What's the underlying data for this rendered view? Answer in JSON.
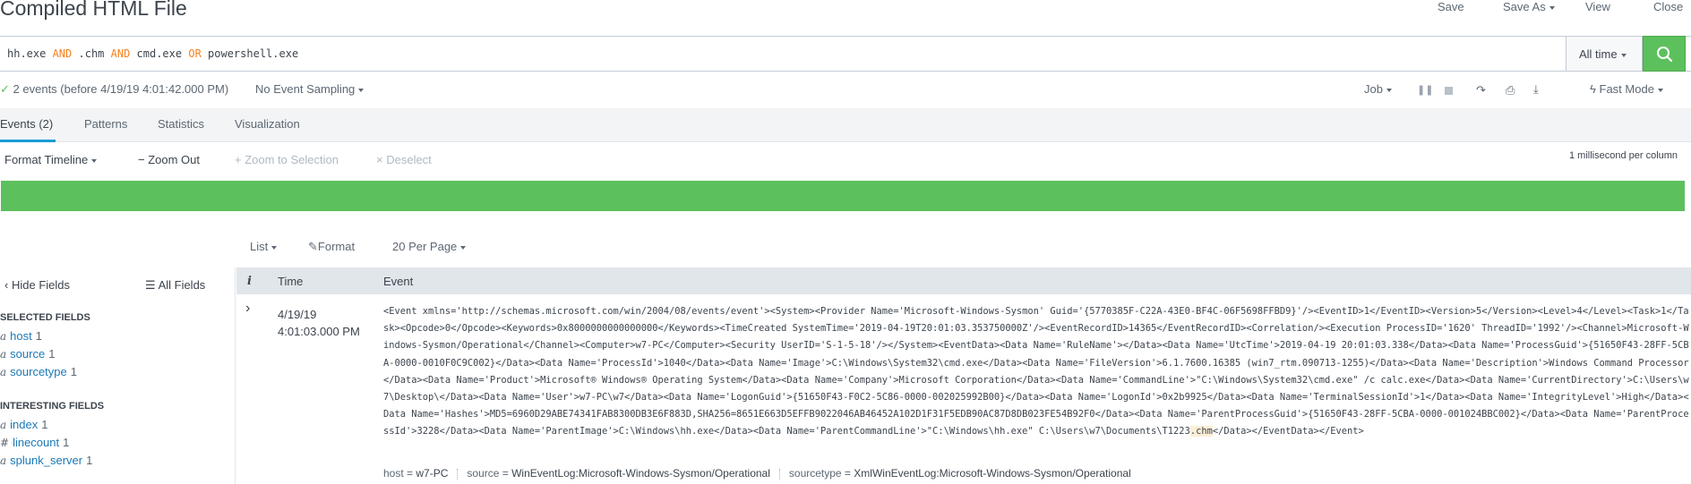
{
  "header": {
    "title": "Compiled HTML File",
    "save": "Save",
    "save_as": "Save As",
    "view": "View",
    "close": "Close"
  },
  "search": {
    "q1": "hh.exe ",
    "op1": "AND",
    "q2": " .chm ",
    "op2": "AND",
    "q3": " cmd.exe ",
    "op3": "OR",
    "q4": " powershell.exe",
    "time_range": "All time",
    "search_icon": "search-icon"
  },
  "status": {
    "summary": "2 events (before 4/19/19 4:01:42.000 PM)",
    "sampling": "No Event Sampling",
    "job": "Job",
    "mode": "Fast Mode"
  },
  "tabs": [
    {
      "label": "Events (2)"
    },
    {
      "label": "Patterns"
    },
    {
      "label": "Statistics"
    },
    {
      "label": "Visualization"
    }
  ],
  "timeline": {
    "format": "Format Timeline",
    "zoom_out": "Zoom Out",
    "zoom_selection": "Zoom to Selection",
    "deselect": "Deselect",
    "scale": "1 millisecond per column",
    "bar_color": "#5cc05c"
  },
  "results": {
    "list": "List",
    "format": "Format",
    "per_page": "20 Per Page",
    "col_info": "i",
    "col_time": "Time",
    "col_event": "Event"
  },
  "sidebar": {
    "hide_fields": "Hide Fields",
    "all_fields": "All Fields",
    "selected_header": "SELECTED FIELDS",
    "selected": [
      {
        "type": "a",
        "name": "host",
        "count": "1"
      },
      {
        "type": "a",
        "name": "source",
        "count": "1"
      },
      {
        "type": "a",
        "name": "sourcetype",
        "count": "1"
      }
    ],
    "interesting_header": "INTERESTING FIELDS",
    "interesting": [
      {
        "type": "a",
        "name": "index",
        "count": "1"
      },
      {
        "type": "#",
        "name": "linecount",
        "count": "1"
      },
      {
        "type": "a",
        "name": "splunk_server",
        "count": "1"
      }
    ]
  },
  "event": {
    "date": "4/19/19",
    "time": "4:01:03.000 PM",
    "raw_a": "<Event xmlns='http://schemas.microsoft.com/win/2004/08/events/event'><System><Provider Name='Microsoft-Windows-Sysmon' Guid='{5770385F-C22A-43E0-BF4C-06F5698FFBD9}'/><EventID>1</EventID><Version>5</Version><Level>4</Level><Task>1</Task><Opcode>0</Opcode><Keywords>0x8000000000000000</Keywords><TimeCreated SystemTime='2019-04-19T20:01:03.353750000Z'/><EventRecordID>14365</EventRecordID><Correlation/><Execution ProcessID='1620' ThreadID='1992'/><Channel>Microsoft-Windows-Sysmon/Operational</Channel><Computer>w7-PC</Computer><Security UserID='S-1-5-18'/></System><EventData><Data Name='RuleName'></Data><Data Name='UtcTime'>2019-04-19 20:01:03.338</Data><Data Name='ProcessGuid'>{51650F43-28FF-5CBA-0000-0010F0C9C002}</Data><Data Name='ProcessId'>1040</Data><Data Name='Image'>C:\\Windows\\System32\\cmd.exe</Data><Data Name='FileVersion'>6.1.7600.16385 (win7_rtm.090713-1255)</Data><Data Name='Description'>Windows Command Processor</Data><Data Name='Product'>Microsoft® Windows® Operating System</Data><Data Name='Company'>Microsoft Corporation</Data><Data Name='CommandLine'>\"C:\\Windows\\System32\\cmd.exe\" /c calc.exe</Data><Data Name='CurrentDirectory'>C:\\Users\\w7\\Desktop\\</Data><Data Name='User'>w7-PC\\w7</Data><Data Name='LogonGuid'>{51650F43-F0C2-5C86-0000-002025992B00}</Data><Data Name='LogonId'>0x2b9925</Data><Data Name='TerminalSessionId'>1</Data><Data Name='IntegrityLevel'>High</Data><Data Name='Hashes'>MD5=6960D29ABE74341FAB8300DB3E6F883D,SHA256=8651E663D5EFFB9022046AB46452A102D1F31F5EDB90AC87D8DB023FE54B92F0</Data><Data Name='ParentProcessGuid'>{51650F43-28FF-5CBA-0000-001024BBC002}</Data><Data Name='ParentProcessId'>3228</Data><Data Name='ParentImage'>C:\\Windows\\hh.exe</Data><Data Name='ParentCommandLine'>\"C:\\Windows\\hh.exe\"  C:\\Users\\w7\\Documents\\T1223",
    "raw_hl": ".chm",
    "raw_b": "</Data></EventData></Event>",
    "meta": [
      {
        "key": "host",
        "value": "w7-PC"
      },
      {
        "key": "source",
        "value": "WinEventLog:Microsoft-Windows-Sysmon/Operational"
      },
      {
        "key": "sourcetype",
        "value": "XmlWinEventLog:Microsoft-Windows-Sysmon/Operational"
      }
    ]
  }
}
